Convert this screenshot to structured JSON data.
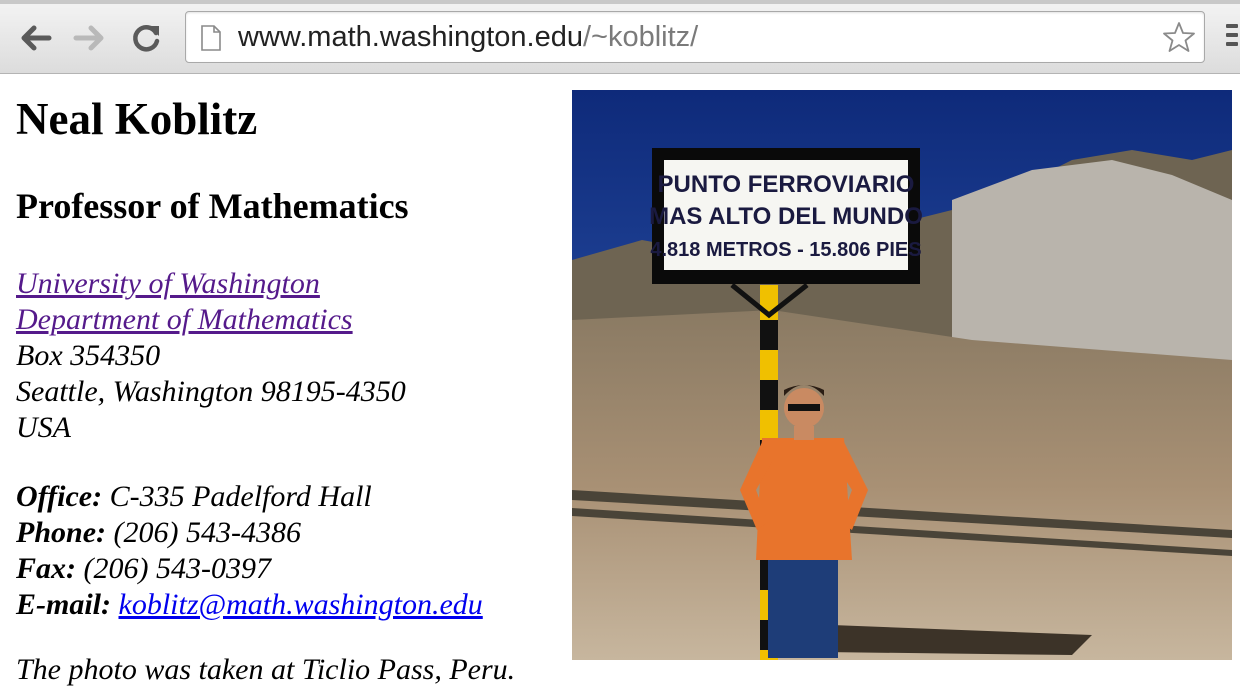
{
  "browser": {
    "url_host": "www.math.washington.edu",
    "url_path": "/~koblitz/"
  },
  "page": {
    "name": "Neal Koblitz",
    "title": "Professor of Mathematics",
    "university_link": "University of Washington",
    "department_link": "Department of Mathematics",
    "address_line1": "Box 354350",
    "address_line2": "Seattle, Washington 98195-4350",
    "address_line3": "USA",
    "office_label": "Office:",
    "office_value": "C-335 Padelford Hall",
    "phone_label": "Phone:",
    "phone_value": "(206) 543-4386",
    "fax_label": "Fax:",
    "fax_value": "(206) 543-0397",
    "email_label": "E-mail:",
    "email_value": "koblitz@math.washington.edu",
    "photo_note": "The photo was taken at Ticlio Pass, Peru."
  },
  "photo": {
    "sign_line1": "PUNTO FERROVIARIO",
    "sign_line2": "MAS ALTO DEL MUNDO",
    "sign_line3": "4.818 METROS - 15.806 PIES"
  },
  "icons": {
    "back": "back-arrow-icon",
    "forward": "forward-arrow-icon",
    "reload": "reload-icon",
    "page": "page-icon",
    "bookmark": "star-icon",
    "menu": "menu-icon"
  }
}
